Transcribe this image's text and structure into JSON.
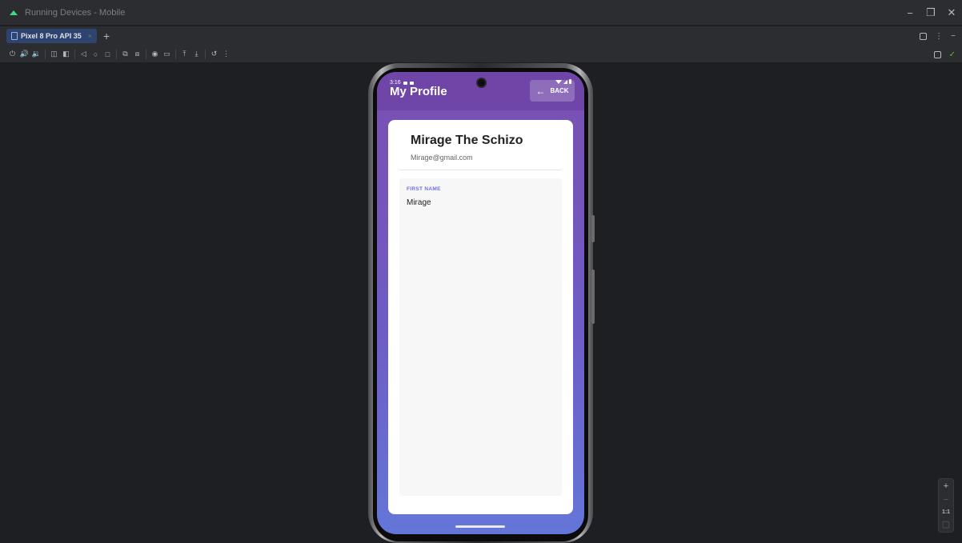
{
  "window": {
    "title": "Running Devices - Mobile",
    "controls": {
      "minimize": "−",
      "restore": "❐",
      "close": "✕"
    }
  },
  "tabs": [
    {
      "label": "Pixel 8 Pro API 35",
      "close": "×"
    }
  ],
  "tab_add": "+",
  "tabrow_right": {
    "more": "⋮",
    "hide": "−"
  },
  "toolbar": {
    "tools": [
      "⏻",
      "🔊",
      "🔉",
      "◫",
      "◧",
      "◁",
      "○",
      "□",
      "⧉",
      "⧈",
      "◉",
      "▭",
      "⤒",
      "⤓",
      "↺",
      "⋮"
    ]
  },
  "device_screen": {
    "status_time": "3:16",
    "app_title": "My Profile",
    "back_button": {
      "arrow": "←",
      "label": "BACK"
    },
    "profile": {
      "name": "Mirage The Schizo",
      "email": "Mirage@gmail.com"
    },
    "fields": [
      {
        "label": "FIRST NAME",
        "value": "Mirage"
      }
    ]
  },
  "zoom": {
    "in": "+",
    "out": "−",
    "actual": "1:1",
    "fit": "▢"
  },
  "colors": {
    "accent": "#6e72d8",
    "appbar": "#6f45a8",
    "gradient_top": "#7b4fb0",
    "gradient_bottom": "#6476d8",
    "check": "#5fb832"
  }
}
